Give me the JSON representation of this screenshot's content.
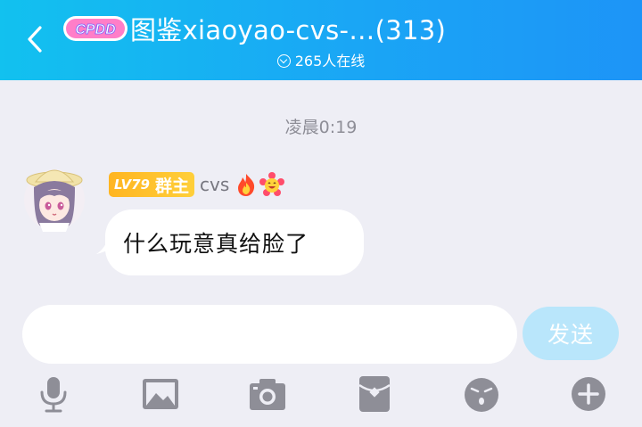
{
  "header": {
    "title": "图鉴xiaoyao-cvs-…(313)",
    "logo_text": "CPDD",
    "online_text": "265人在线"
  },
  "chat": {
    "timestamp": "凌晨0:19",
    "messages": [
      {
        "level": "LV79",
        "role": "群主",
        "nickname": "cvs",
        "text": "什么玩意真给脸了"
      }
    ]
  },
  "composer": {
    "input_value": "",
    "send_label": "发送"
  },
  "toolbar": {
    "icons": [
      "microphone-icon",
      "image-icon",
      "camera-icon",
      "red-packet-icon",
      "emoji-icon",
      "plus-icon"
    ]
  },
  "colors": {
    "header_start": "#12c1ef",
    "header_end": "#1d94f7",
    "background": "#eeeef5",
    "send_button": "#b9e6fb",
    "badge": "#ffb521",
    "icon_gray": "#8e8e97"
  }
}
